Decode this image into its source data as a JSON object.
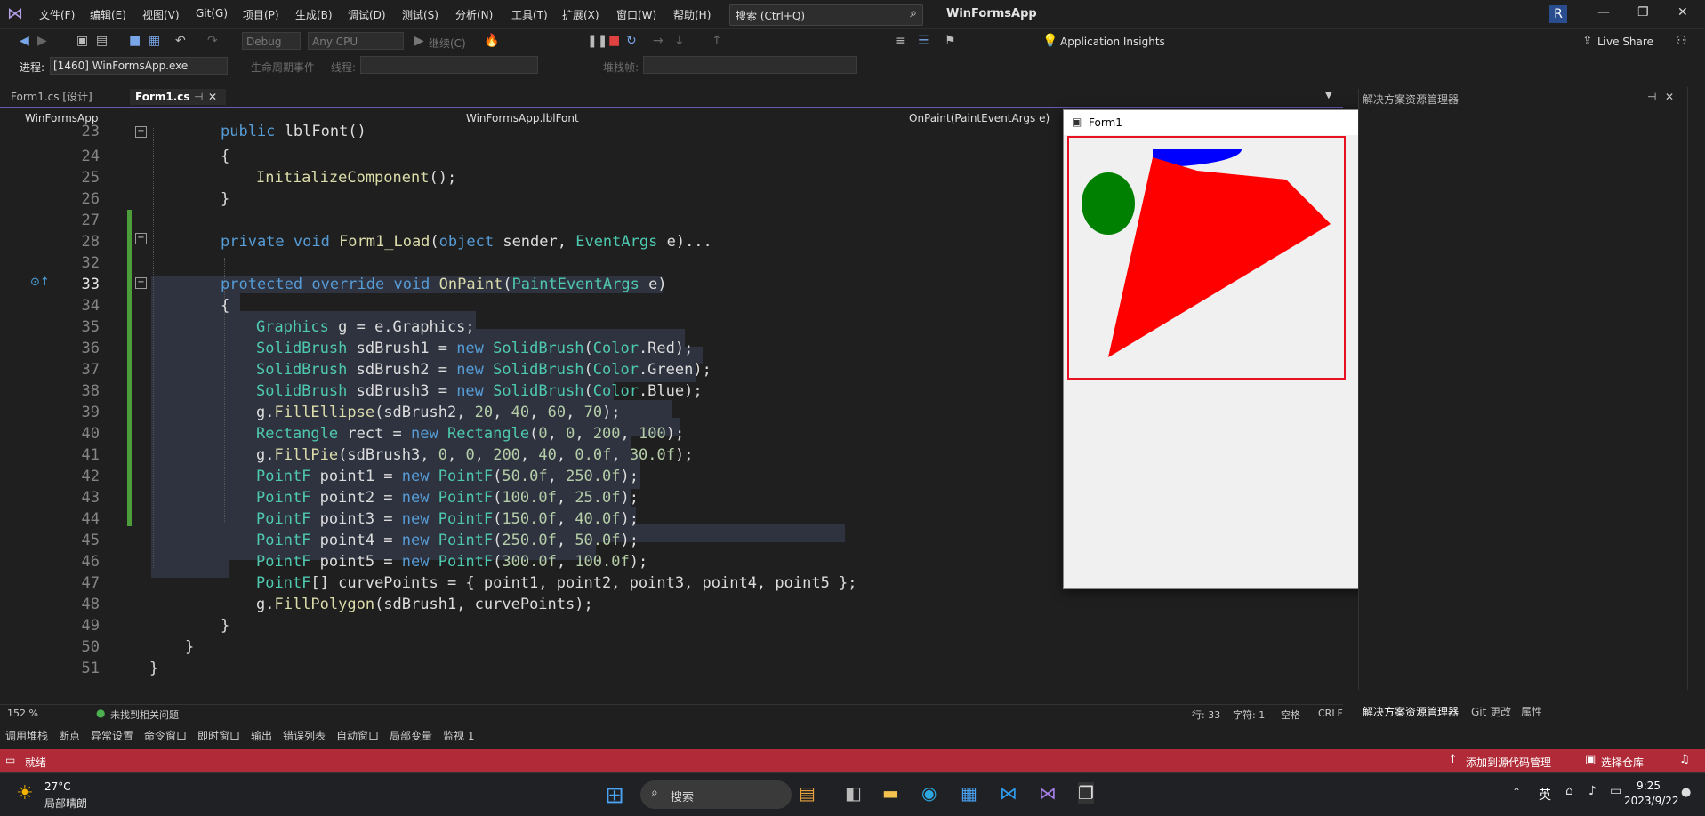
{
  "menu": {
    "items": [
      "文件(F)",
      "编辑(E)",
      "视图(V)",
      "Git(G)",
      "项目(P)",
      "生成(B)",
      "调试(D)",
      "测试(S)",
      "分析(N)",
      "工具(T)",
      "扩展(X)",
      "窗口(W)",
      "帮助(H)"
    ],
    "search_placeholder": "搜索 (Ctrl+Q)",
    "app_title": "WinFormsApp",
    "avatar_letter": "R"
  },
  "toolbar": {
    "config": "Debug",
    "platform": "Any CPU",
    "continue_label": "继续(C)",
    "app_insights": "Application Insights",
    "live_share": "Live Share"
  },
  "debugbar": {
    "process_label": "进程:",
    "process_value": "[1460] WinFormsApp.exe",
    "lifecycle_label": "生命周期事件",
    "thread_label": "线程:",
    "stackframe_label": "堆栈帧:"
  },
  "tabs": [
    {
      "label": "Form1.cs [设计]",
      "active": false
    },
    {
      "label": "Form1.cs",
      "active": true
    }
  ],
  "navbar": {
    "project": "WinFormsApp",
    "type": "WinFormsApp.lblFont",
    "member": "OnPaint(PaintEventArgs e)"
  },
  "editor": {
    "line_numbers": [
      "23",
      "24",
      "25",
      "26",
      "27",
      "28",
      "32",
      "33",
      "34",
      "35",
      "36",
      "37",
      "38",
      "39",
      "40",
      "41",
      "42",
      "43",
      "44",
      "45",
      "46",
      "47",
      "48",
      "49",
      "50",
      "51"
    ],
    "current_line": "33",
    "zoom": "152 %",
    "issues": "未找到相关问题",
    "position_line": "行: 33",
    "position_col": "字符: 1",
    "whitespace": "空格",
    "line_ending": "CRLF"
  },
  "form1": {
    "title": "Form1"
  },
  "solution_panel": {
    "title": "解决方案资源管理器",
    "tabs": [
      "解决方案资源管理器",
      "Git 更改",
      "属性"
    ]
  },
  "bottom_tabs": [
    "调用堆栈",
    "断点",
    "异常设置",
    "命令窗口",
    "即时窗口",
    "输出",
    "错误列表",
    "自动窗口",
    "局部变量",
    "监视 1"
  ],
  "statusbar": {
    "ready": "就绪",
    "add_source": "添加到源代码管理",
    "select_repo": "选择仓库"
  },
  "taskbar": {
    "temperature": "27°C",
    "weather": "局部晴朗",
    "search": "搜索",
    "ime": "英",
    "time": "9:25",
    "date": "2023/9/22"
  },
  "colors": {
    "accent": "#6b55b7",
    "statusbar": "#b02a37",
    "change_bar": "#4d9e3a",
    "pie_blue": "#0000ff",
    "ellipse_green": "#008000",
    "polygon_red": "#ff0000",
    "highlight_box": "#e81123"
  },
  "icons": [
    "vs-logo-icon",
    "search-icon",
    "back-icon",
    "forward-icon",
    "save-icon",
    "save-all-icon",
    "undo-icon",
    "redo-icon",
    "continue-icon",
    "pause-icon",
    "stop-icon",
    "restart-icon",
    "lightbulb-icon",
    "live-share-icon",
    "close-icon",
    "pin-icon",
    "gear-icon",
    "breakpoint-icon",
    "windows-start-icon",
    "weather-icon"
  ]
}
